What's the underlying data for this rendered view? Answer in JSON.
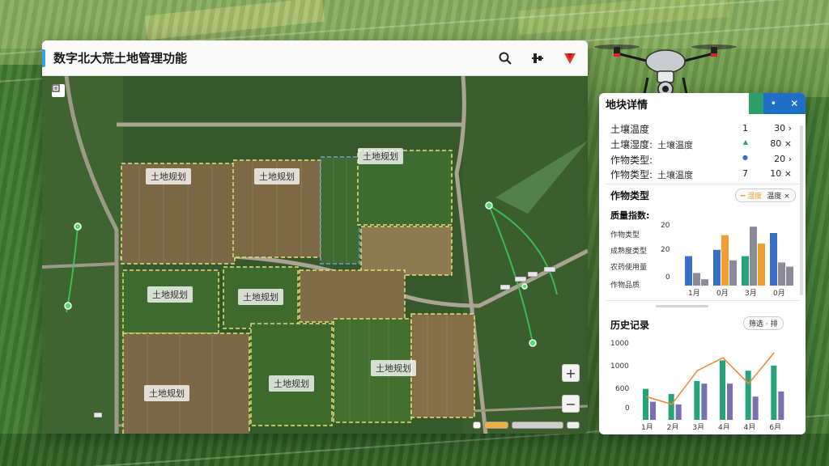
{
  "window": {
    "title": "数字北大荒土地管理功能",
    "toolbar": {
      "search_icon": "search-icon",
      "layers_icon": "layers-icon",
      "alert_icon": "alert-icon"
    }
  },
  "map": {
    "plots": [
      {
        "id": "p1",
        "label": "土地规划"
      },
      {
        "id": "p2",
        "label": "土地规划"
      },
      {
        "id": "p3",
        "label": "土地规划"
      },
      {
        "id": "p4",
        "label": "土地规划"
      },
      {
        "id": "p5",
        "label": "土地规划"
      },
      {
        "id": "p6",
        "label": "土地规划"
      },
      {
        "id": "p7",
        "label": "土地规划"
      },
      {
        "id": "p8",
        "label": "土地规划"
      }
    ],
    "zoom_in": "+",
    "zoom_out": "−"
  },
  "panel": {
    "title": "地块详情",
    "close": "✕",
    "minimize": "•",
    "details": [
      {
        "label": "土壤温度",
        "mid": "",
        "value": "1",
        "value2": "30 ›"
      },
      {
        "label": "土壤湿度:",
        "mid": "土壤温度",
        "value": "▲",
        "value2": "80 ×"
      },
      {
        "label": "作物类型:",
        "mid": "",
        "value": "●",
        "value2": "20 ›"
      },
      {
        "label": "作物类型:",
        "mid": "土壤温度",
        "value": "7",
        "value2": "10 ×"
      }
    ],
    "crop_section": {
      "title": "作物类型",
      "pill_left": "━ 湿度",
      "pill_right": "温度 ×"
    },
    "quality_label": "质量指数:",
    "quality_items": [
      "作物类型",
      "成熟度类型",
      "农药使用量",
      "作物品质"
    ],
    "bar_chart": {
      "yticks": [
        "20",
        "20",
        "0"
      ],
      "categories": [
        "1月",
        "0月",
        "3月",
        "0月"
      ]
    },
    "history": {
      "title": "历史记录",
      "pill": "筛选 · 排",
      "yticks": [
        "1000",
        "1000",
        "600",
        "0"
      ],
      "categories": [
        "1月",
        "2月",
        "3月",
        "4月",
        "4月",
        "6月"
      ]
    },
    "colors": {
      "teal": "#27a37a",
      "purple": "#7a6fb0",
      "blue": "#3a6fc8",
      "orange": "#f0a030",
      "gray": "#8a8a9a",
      "line": "#f08a3a"
    }
  },
  "chart_data": [
    {
      "type": "bar",
      "categories": [
        "1月",
        "0月",
        "3月",
        "0月"
      ],
      "series": [
        {
          "values": [
            14,
            17,
            14,
            25
          ]
        },
        {
          "values": [
            6,
            24,
            28,
            11
          ]
        },
        {
          "values": [
            3,
            12,
            20,
            9
          ]
        }
      ],
      "ylim": [
        0,
        30
      ]
    },
    {
      "type": "bar",
      "categories": [
        "1月",
        "2月",
        "3月",
        "4月",
        "4月",
        "6月"
      ],
      "series": [
        {
          "values": [
            600,
            500,
            750,
            1150,
            950,
            1050
          ]
        },
        {
          "values": [
            350,
            300,
            700,
            700,
            450,
            550
          ]
        }
      ],
      "line": [
        450,
        300,
        950,
        1200,
        700,
        1300
      ],
      "ylim": [
        0,
        1500
      ]
    }
  ]
}
